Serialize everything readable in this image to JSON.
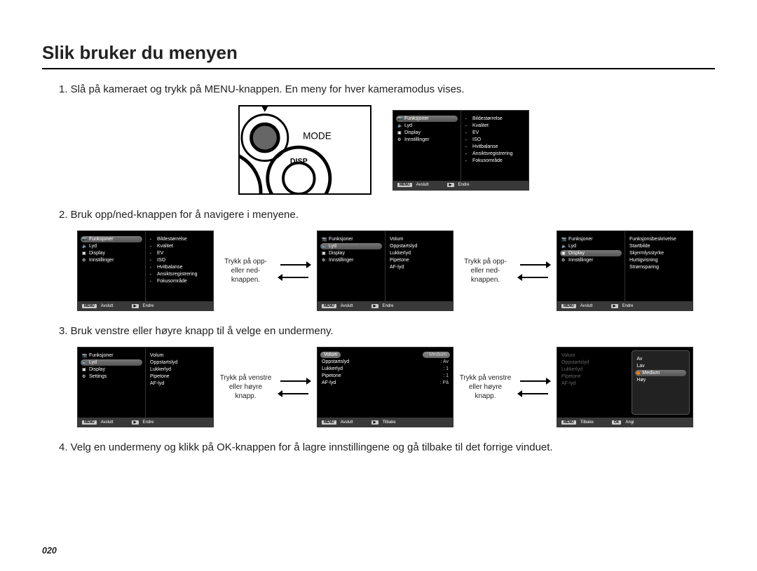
{
  "title": "Slik bruker du menyen",
  "page_number": "020",
  "steps": {
    "s1": "1. Slå på kameraet og trykk på MENU-knappen. En meny for hver kameramodus vises.",
    "s2": "2. Bruk opp/ned-knappen for å navigere i menyene.",
    "s3": "3. Bruk venstre eller høyre knapp til å velge en undermeny.",
    "s4": "4. Velg en undermeny og klikk på OK-knappen for å lagre innstillingene og gå tilbake til det forrige vinduet."
  },
  "hints": {
    "updown": "Trykk på opp- eller ned-knappen.",
    "leftright": "Trykk på venstre eller høyre knapp."
  },
  "camera_labels": {
    "menu": "MENU",
    "mode": "MODE",
    "disp": "DISP"
  },
  "left_menus": {
    "funksjoner": "Funksjoner",
    "lyd": "Lyd",
    "display": "Display",
    "innstillinger": "Innstillinger",
    "settings": "Settings"
  },
  "funcs_right": {
    "bildestorrelse": "Bildestørrelse",
    "kvalitet": "Kvalitet",
    "ev": "EV",
    "iso": "ISO",
    "hvitbalanse": "Hvitbalanse",
    "ansikt": "Ansiktsregistrering",
    "fokus": "Fokusområde"
  },
  "lyd_right": {
    "volum": "Volum",
    "oppstart": "Oppstartslyd",
    "lukker": "Lukkerlyd",
    "pipetone": "Pipetone",
    "aflyd": "AF-lyd"
  },
  "display_right": {
    "funkbeskr": "Funksjonsbeskrivelse",
    "startbilde": "Startbilde",
    "skjermlys": "Skjermlysstyrke",
    "hurtig": "Hurtigvisning",
    "stromsparing": "Strømsparing"
  },
  "volum_values": {
    "medium": ": Medium",
    "av": ": Av",
    "one": ": 1",
    "paa": ": På"
  },
  "volum_options": {
    "av": "Av",
    "lav": "Lav",
    "medium": "Medium",
    "hoy": "Høy"
  },
  "status": {
    "menu_key": "MENU",
    "avslutt": "Avslutt",
    "play_key": "▶",
    "endre": "Endre",
    "tilbake": "Tilbake",
    "ok_key": "OK",
    "angi": "Angi"
  }
}
